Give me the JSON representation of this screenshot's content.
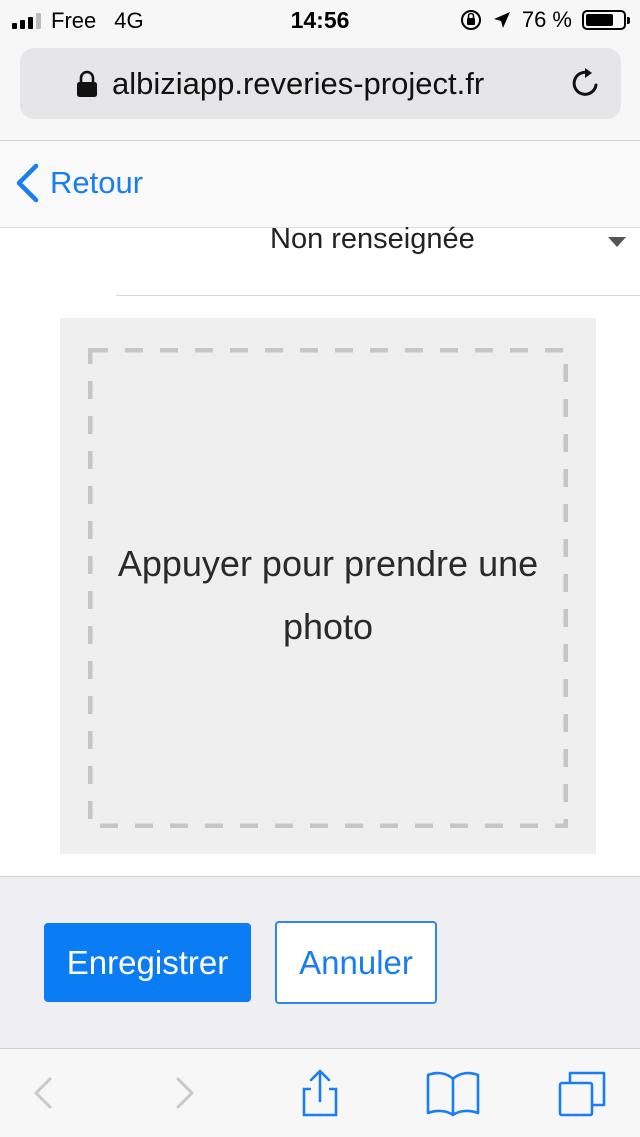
{
  "status_bar": {
    "carrier": "Free",
    "network": "4G",
    "time": "14:56",
    "battery_text": "76 %",
    "battery_level": 0.76
  },
  "browser": {
    "url": "albiziapp.reveries-project.fr"
  },
  "nav": {
    "back_label": "Retour"
  },
  "form": {
    "select_value": "Non renseignée",
    "photo_prompt": "Appuyer pour prendre une photo"
  },
  "actions": {
    "save_label": "Enregistrer",
    "cancel_label": "Annuler"
  },
  "colors": {
    "accent": "#0a7cf4",
    "link": "#1a7df0",
    "footer_bg": "#efeff3",
    "photo_bg": "#efefef"
  },
  "icons": {
    "lock": "lock-icon",
    "reload": "reload-icon",
    "back": "chevron-left-icon",
    "caret": "caret-down-icon",
    "share": "share-icon",
    "bookmarks": "book-icon",
    "tabs": "tabs-icon"
  }
}
